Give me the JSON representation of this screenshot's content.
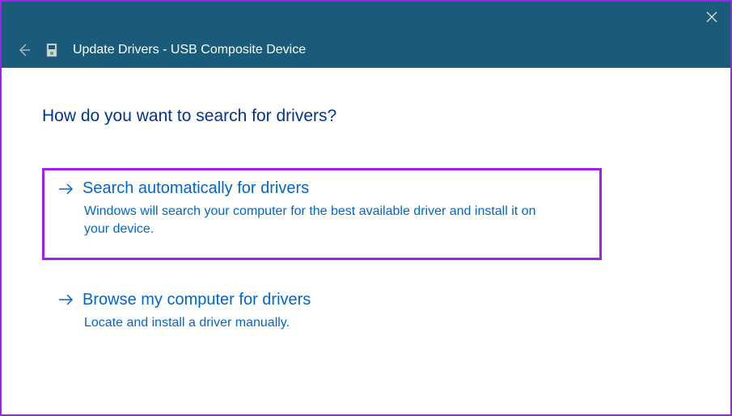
{
  "header": {
    "title": "Update Drivers - USB Composite Device"
  },
  "page": {
    "heading": "How do you want to search for drivers?"
  },
  "options": [
    {
      "title": "Search automatically for drivers",
      "description": "Windows will search your computer for the best available driver and install it on your device."
    },
    {
      "title": "Browse my computer for drivers",
      "description": "Locate and install a driver manually."
    }
  ]
}
